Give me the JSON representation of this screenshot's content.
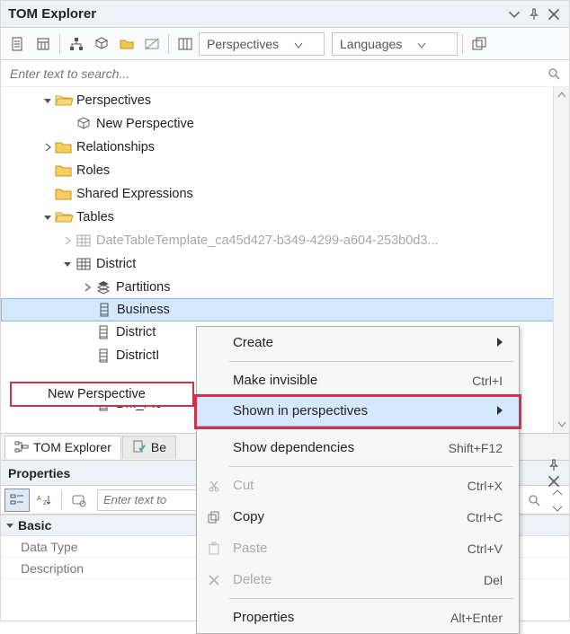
{
  "panel": {
    "title": "TOM Explorer"
  },
  "toolbar": {
    "perspectives_combo": "Perspectives",
    "languages_combo": "Languages"
  },
  "search": {
    "placeholder": "Enter text to search..."
  },
  "tree": {
    "perspectives": "Perspectives",
    "new_perspective": "New Perspective",
    "relationships": "Relationships",
    "roles": "Roles",
    "shared_expressions": "Shared Expressions",
    "tables": "Tables",
    "datetable": "DateTableTemplate_ca45d427-b349-4299-a604-253b0d3...",
    "district": "District",
    "partitions": "Partitions",
    "business": "Business",
    "district_col": "District",
    "districtid": "DistrictI",
    "dm_pic": "DM_Pic"
  },
  "badge": {
    "label": "New Perspective"
  },
  "context_menu": {
    "create": "Create",
    "make_invisible": "Make invisible",
    "make_invisible_sc": "Ctrl+I",
    "shown_in": "Shown in perspectives",
    "show_deps": "Show dependencies",
    "show_deps_sc": "Shift+F12",
    "cut": "Cut",
    "cut_sc": "Ctrl+X",
    "copy": "Copy",
    "copy_sc": "Ctrl+C",
    "paste": "Paste",
    "paste_sc": "Ctrl+V",
    "delete": "Delete",
    "delete_sc": "Del",
    "properties": "Properties",
    "properties_sc": "Alt+Enter"
  },
  "bottom_tabs": {
    "tom": "TOM Explorer",
    "be": "Be"
  },
  "props": {
    "title": "Properties",
    "search_placeholder": "Enter text to",
    "group_basic": "Basic",
    "data_type": "Data Type",
    "description": "Description"
  }
}
